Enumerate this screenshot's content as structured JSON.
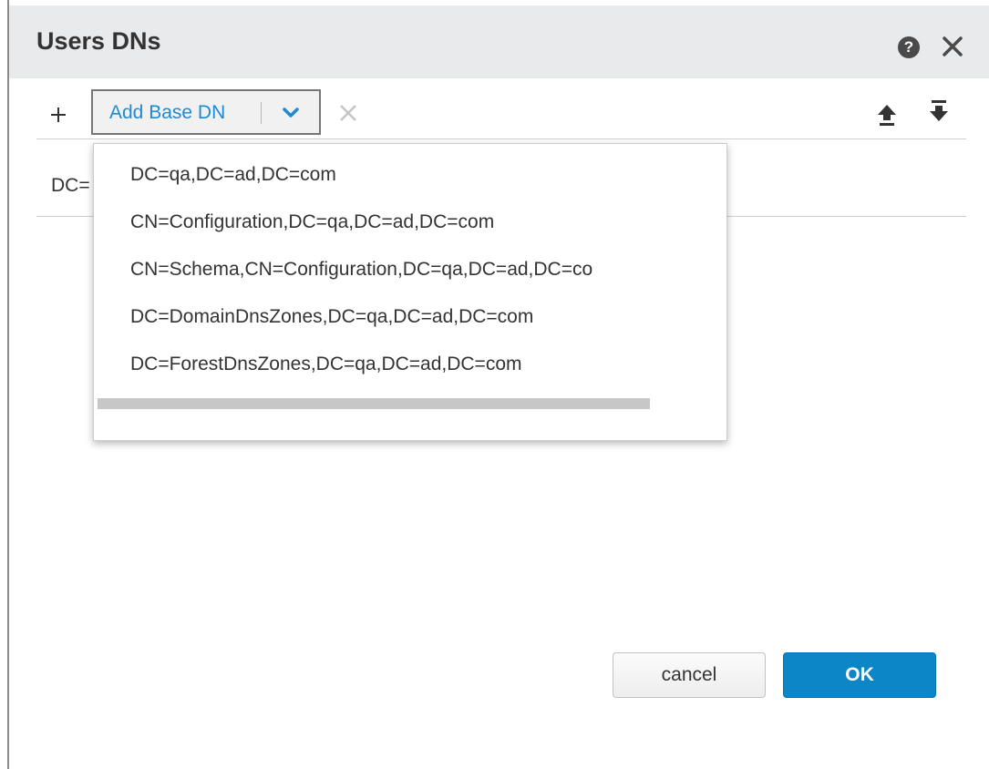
{
  "dialog": {
    "title": "Users DNs",
    "help_icon": "help-icon",
    "help_glyph": "?",
    "close_icon": "close-icon"
  },
  "toolbar": {
    "add_icon": "plus-icon",
    "add_base_dn_label": "Add Base DN",
    "dropdown_icon": "chevron-down-icon",
    "remove_icon": "close-icon",
    "move_up_icon": "move-up-icon",
    "move_down_icon": "move-down-icon"
  },
  "list": {
    "rows": [
      {
        "label": "DC="
      }
    ]
  },
  "dropdown_menu": {
    "options": [
      "DC=qa,DC=ad,DC=com",
      "CN=Configuration,DC=qa,DC=ad,DC=com",
      "CN=Schema,CN=Configuration,DC=qa,DC=ad,DC=co",
      "DC=DomainDnsZones,DC=qa,DC=ad,DC=com",
      "DC=ForestDnsZones,DC=qa,DC=ad,DC=com"
    ]
  },
  "footer": {
    "cancel_label": "cancel",
    "ok_label": "OK"
  },
  "colors": {
    "accent": "#0d86c8",
    "link": "#1f8ad4",
    "titlebar_bg": "#e8eaec"
  }
}
